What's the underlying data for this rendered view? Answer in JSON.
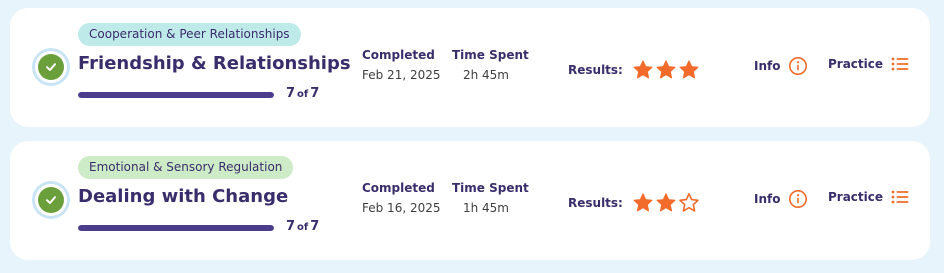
{
  "colors": {
    "accent": "#f26b2a",
    "primary_text": "#3a2d6b",
    "check_green": "#6a9f3c",
    "progress_fill": "#4b3d8c",
    "background": "#e8f4fc"
  },
  "icons": {
    "completed": "check-circle-icon",
    "star_filled": "star-filled-icon",
    "star_empty": "star-outline-icon",
    "info": "info-circle-icon",
    "practice": "list-icon"
  },
  "activities": [
    {
      "category": "Cooperation & Peer Relationships",
      "category_color": "#bfeaea",
      "title": "Friendship & Relationships",
      "progress_done": "7",
      "progress_of": "of",
      "progress_total": "7",
      "progress_fraction": 1.0,
      "completed_label": "Completed",
      "completed_date": "Feb 21, 2025",
      "time_label": "Time Spent",
      "time_value": "2h 45m",
      "results_label": "Results:",
      "stars_filled": 3,
      "stars_total": 3,
      "info_label": "Info",
      "practice_label": "Practice"
    },
    {
      "category": "Emotional & Sensory Regulation",
      "category_color": "#cdebc6",
      "title": "Dealing with Change",
      "progress_done": "7",
      "progress_of": "of",
      "progress_total": "7",
      "progress_fraction": 1.0,
      "completed_label": "Completed",
      "completed_date": "Feb 16, 2025",
      "time_label": "Time Spent",
      "time_value": "1h 45m",
      "results_label": "Results:",
      "stars_filled": 2,
      "stars_total": 3,
      "info_label": "Info",
      "practice_label": "Practice"
    }
  ]
}
